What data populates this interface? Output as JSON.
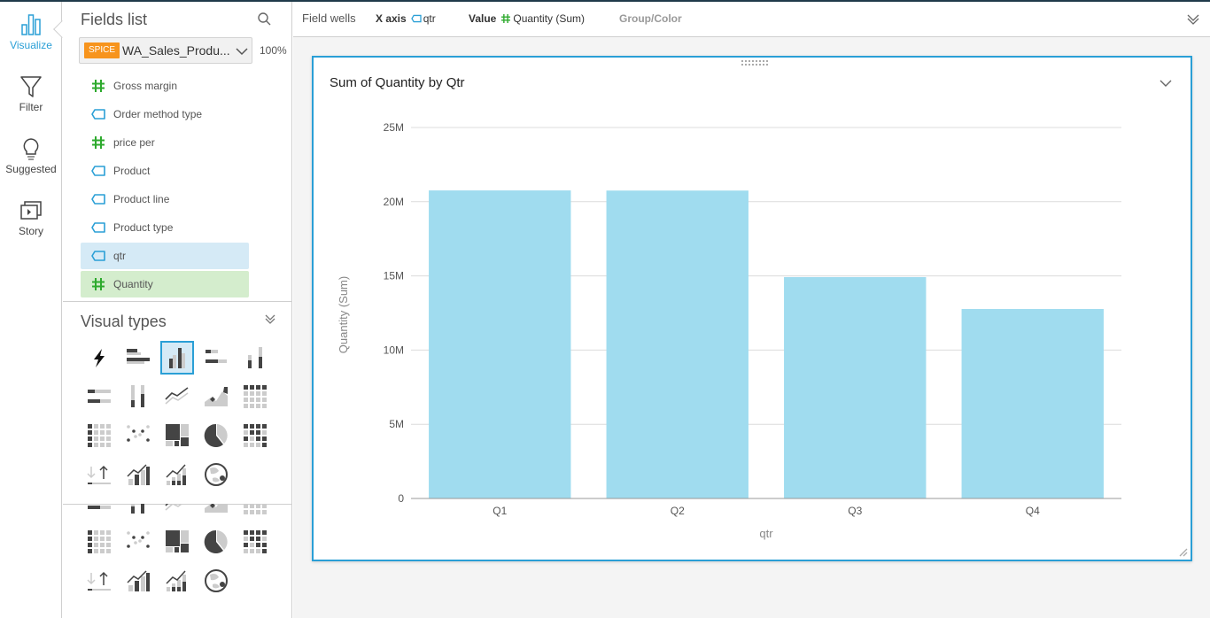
{
  "rail": {
    "items": [
      {
        "label": "Visualize",
        "icon": "bar-chart-icon",
        "active": true
      },
      {
        "label": "Filter",
        "icon": "funnel-icon",
        "active": false
      },
      {
        "label": "Suggested",
        "icon": "lightbulb-icon",
        "active": false
      },
      {
        "label": "Story",
        "icon": "story-icon",
        "active": false
      }
    ]
  },
  "fields_panel": {
    "title": "Fields list",
    "dataset": {
      "badge": "SPICE",
      "name": "WA_Sales_Produ...",
      "percent": "100%"
    },
    "fields": [
      {
        "label": "Gross margin",
        "type": "measure",
        "selected": false
      },
      {
        "label": "Order method type",
        "type": "dimension",
        "selected": false
      },
      {
        "label": "price per",
        "type": "measure",
        "selected": false
      },
      {
        "label": "Product",
        "type": "dimension",
        "selected": false
      },
      {
        "label": "Product line",
        "type": "dimension",
        "selected": false
      },
      {
        "label": "Product type",
        "type": "dimension",
        "selected": false
      },
      {
        "label": "qtr",
        "type": "dimension",
        "selected": true
      },
      {
        "label": "Quantity",
        "type": "measure",
        "selected": true
      }
    ]
  },
  "visual_types": {
    "title": "Visual types",
    "selected": "vertical-bar-chart",
    "types": [
      "autograph",
      "horizontal-bar-chart",
      "vertical-bar-chart",
      "horizontal-stacked-bar-chart",
      "vertical-stacked-bar-chart",
      "horizontal-100-stacked-bar-chart",
      "vertical-100-stacked-bar-chart",
      "line-chart",
      "area-line-chart",
      "pivot-table",
      "table",
      "scatter-plot",
      "tree-map",
      "pie-chart",
      "heat-map",
      "kpi",
      "combo-bar-line-chart",
      "combo-stacked-bar-line-chart",
      "geospatial-map"
    ]
  },
  "field_wells": {
    "label": "Field wells",
    "x_axis_label": "X axis",
    "x_axis_value": "qtr",
    "value_label": "Value",
    "value_value": "Quantity (Sum)",
    "group_label": "Group/Color"
  },
  "visual": {
    "title": "Sum of Quantity by Qtr"
  },
  "colors": {
    "accent": "#2a9fd6",
    "bar": "#a0dcef",
    "spice": "#f7941d",
    "measure": "#2eaa2e",
    "dimension": "#2a9fd6"
  },
  "chart_data": {
    "type": "bar",
    "title": "Sum of Quantity by Qtr",
    "xlabel": "qtr",
    "ylabel": "Quantity (Sum)",
    "categories": [
      "Q1",
      "Q2",
      "Q3",
      "Q4"
    ],
    "values": [
      20760000,
      20750000,
      14920000,
      12770000
    ],
    "ylim": [
      0,
      25000000
    ],
    "yticks": [
      0,
      5000000,
      10000000,
      15000000,
      20000000,
      25000000
    ],
    "ytick_labels": [
      "0",
      "5M",
      "10M",
      "15M",
      "20M",
      "25M"
    ],
    "grid": true,
    "legend": "none"
  }
}
